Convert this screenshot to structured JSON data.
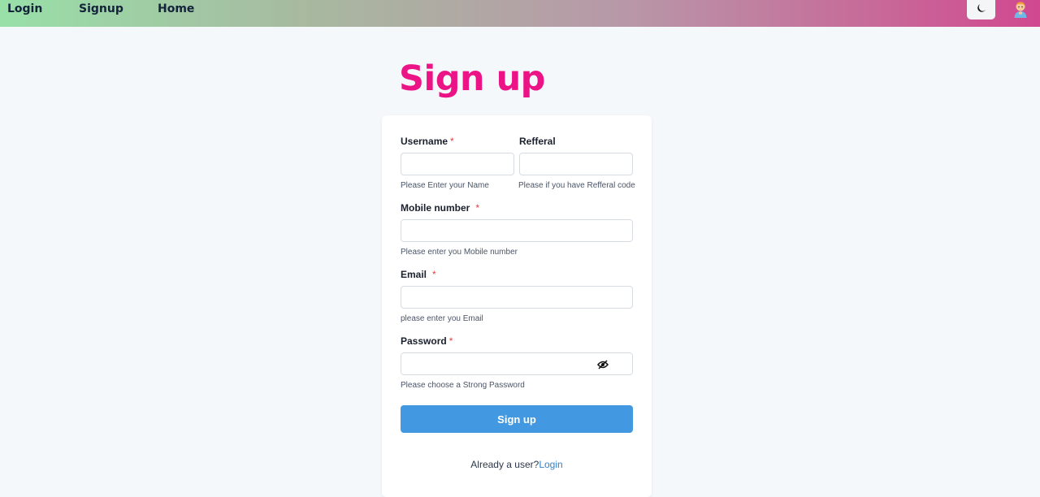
{
  "nav": {
    "login": "Login",
    "signup": "Signup",
    "home": "Home"
  },
  "header": {
    "theme_toggle_icon": "moon-icon",
    "avatar_icon": "user-avatar"
  },
  "page_title": "Sign up",
  "form": {
    "username": {
      "label": "Username",
      "required": "*",
      "value": "",
      "help": "Please Enter your Name"
    },
    "referral": {
      "label": "Refferal",
      "value": "",
      "help": "Please if you have Refferal code"
    },
    "mobile": {
      "label": "Mobile number",
      "required": "*",
      "value": "",
      "help": "Please enter you Mobile number"
    },
    "email": {
      "label": "Email",
      "required": "*",
      "value": "",
      "help": "please enter you Email"
    },
    "password": {
      "label": "Password",
      "required": "*",
      "value": "",
      "help": "Please choose a Strong Password",
      "toggle_icon": "eye-slash-icon"
    },
    "submit_label": "Sign up",
    "already_user_text": "Already a user?",
    "login_link": "Login"
  },
  "colors": {
    "title": "#ec1386",
    "button": "#4299e1",
    "link": "#3182ce",
    "required": "#e53e3e"
  }
}
